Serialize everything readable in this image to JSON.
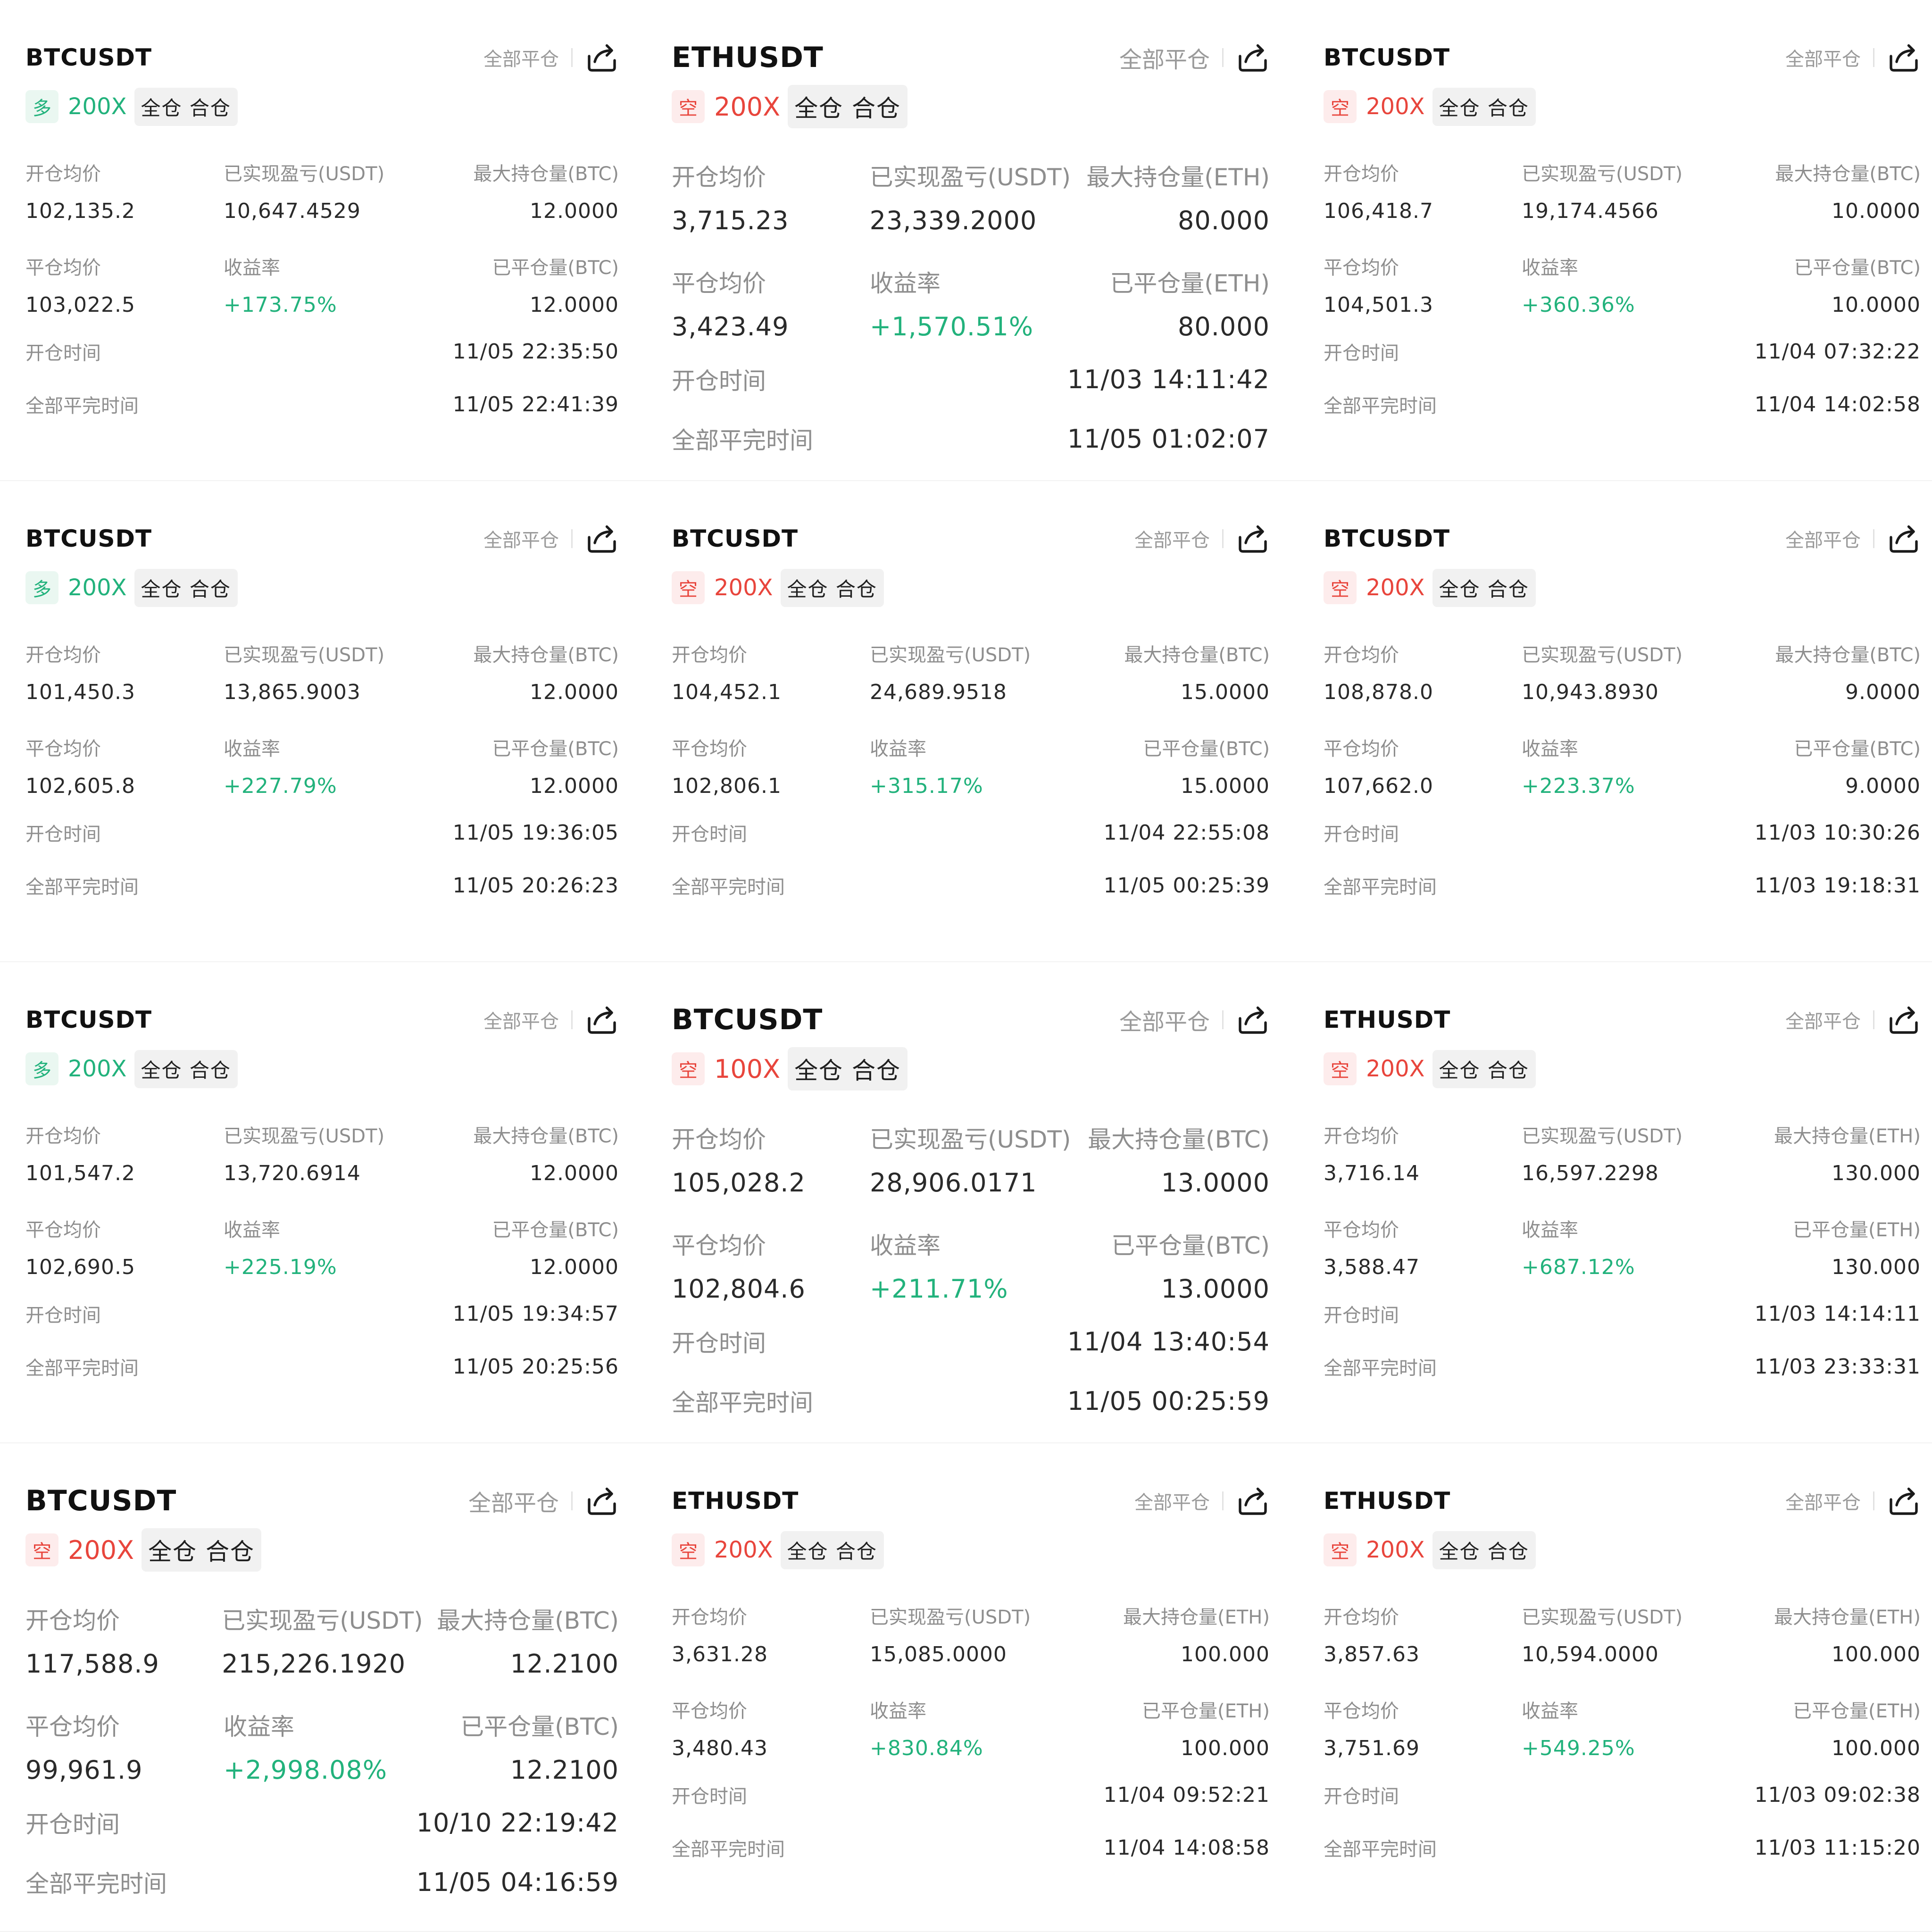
{
  "labels": {
    "close_all": "全部平仓",
    "cross": "全仓 合仓",
    "open_avg": "开仓均价",
    "realized_pnl": "已实现盈亏(USDT)",
    "close_avg": "平仓均价",
    "roi": "收益率",
    "open_time": "开仓时间",
    "close_time": "全部平完时间"
  },
  "colors": {
    "long": "#22b27c",
    "short": "#e8453c",
    "label": "#8e8e8e"
  },
  "cards": [
    {
      "symbol": "BTCUSDT",
      "side": "多",
      "side_type": "long",
      "leverage": "200X",
      "open_avg": "102,135.2",
      "pnl": "10,647.4529",
      "max_label": "最大持仓量(BTC)",
      "max_qty": "12.0000",
      "close_avg": "103,022.5",
      "roi": "+173.75%",
      "closed_label": "已平仓量(BTC)",
      "closed_qty": "12.0000",
      "open_time": "11/05 22:35:50",
      "close_time": "11/05 22:41:39"
    },
    {
      "symbol": "ETHUSDT",
      "side": "空",
      "side_type": "short",
      "leverage": "200X",
      "open_avg": "3,715.23",
      "pnl": "23,339.2000",
      "max_label": "最大持仓量(ETH)",
      "max_qty": "80.000",
      "close_avg": "3,423.49",
      "roi": "+1,570.51%",
      "closed_label": "已平仓量(ETH)",
      "closed_qty": "80.000",
      "open_time": "11/03 14:11:42",
      "close_time": "11/05 01:02:07"
    },
    {
      "symbol": "BTCUSDT",
      "side": "空",
      "side_type": "short",
      "leverage": "200X",
      "open_avg": "106,418.7",
      "pnl": "19,174.4566",
      "max_label": "最大持仓量(BTC)",
      "max_qty": "10.0000",
      "close_avg": "104,501.3",
      "roi": "+360.36%",
      "closed_label": "已平仓量(BTC)",
      "closed_qty": "10.0000",
      "open_time": "11/04 07:32:22",
      "close_time": "11/04 14:02:58"
    },
    {
      "symbol": "BTCUSDT",
      "side": "多",
      "side_type": "long",
      "leverage": "200X",
      "open_avg": "101,450.3",
      "pnl": "13,865.9003",
      "max_label": "最大持仓量(BTC)",
      "max_qty": "12.0000",
      "close_avg": "102,605.8",
      "roi": "+227.79%",
      "closed_label": "已平仓量(BTC)",
      "closed_qty": "12.0000",
      "open_time": "11/05 19:36:05",
      "close_time": "11/05 20:26:23"
    },
    {
      "symbol": "BTCUSDT",
      "side": "空",
      "side_type": "short",
      "leverage": "200X",
      "open_avg": "104,452.1",
      "pnl": "24,689.9518",
      "max_label": "最大持仓量(BTC)",
      "max_qty": "15.0000",
      "close_avg": "102,806.1",
      "roi": "+315.17%",
      "closed_label": "已平仓量(BTC)",
      "closed_qty": "15.0000",
      "open_time": "11/04 22:55:08",
      "close_time": "11/05 00:25:39"
    },
    {
      "symbol": "BTCUSDT",
      "side": "空",
      "side_type": "short",
      "leverage": "200X",
      "open_avg": "108,878.0",
      "pnl": "10,943.8930",
      "max_label": "最大持仓量(BTC)",
      "max_qty": "9.0000",
      "close_avg": "107,662.0",
      "roi": "+223.37%",
      "closed_label": "已平仓量(BTC)",
      "closed_qty": "9.0000",
      "open_time": "11/03 10:30:26",
      "close_time": "11/03 19:18:31"
    },
    {
      "symbol": "BTCUSDT",
      "side": "多",
      "side_type": "long",
      "leverage": "200X",
      "open_avg": "101,547.2",
      "pnl": "13,720.6914",
      "max_label": "最大持仓量(BTC)",
      "max_qty": "12.0000",
      "close_avg": "102,690.5",
      "roi": "+225.19%",
      "closed_label": "已平仓量(BTC)",
      "closed_qty": "12.0000",
      "open_time": "11/05 19:34:57",
      "close_time": "11/05 20:25:56"
    },
    {
      "symbol": "BTCUSDT",
      "side": "空",
      "side_type": "short",
      "leverage": "100X",
      "open_avg": "105,028.2",
      "pnl": "28,906.0171",
      "max_label": "最大持仓量(BTC)",
      "max_qty": "13.0000",
      "close_avg": "102,804.6",
      "roi": "+211.71%",
      "closed_label": "已平仓量(BTC)",
      "closed_qty": "13.0000",
      "open_time": "11/04 13:40:54",
      "close_time": "11/05 00:25:59"
    },
    {
      "symbol": "ETHUSDT",
      "side": "空",
      "side_type": "short",
      "leverage": "200X",
      "open_avg": "3,716.14",
      "pnl": "16,597.2298",
      "max_label": "最大持仓量(ETH)",
      "max_qty": "130.000",
      "close_avg": "3,588.47",
      "roi": "+687.12%",
      "closed_label": "已平仓量(ETH)",
      "closed_qty": "130.000",
      "open_time": "11/03 14:14:11",
      "close_time": "11/03 23:33:31"
    },
    {
      "symbol": "BTCUSDT",
      "side": "空",
      "side_type": "short",
      "leverage": "200X",
      "open_avg": "117,588.9",
      "pnl": "215,226.1920",
      "max_label": "最大持仓量(BTC)",
      "max_qty": "12.2100",
      "close_avg": "99,961.9",
      "roi": "+2,998.08%",
      "closed_label": "已平仓量(BTC)",
      "closed_qty": "12.2100",
      "open_time": "10/10 22:19:42",
      "close_time": "11/05 04:16:59"
    },
    {
      "symbol": "ETHUSDT",
      "side": "空",
      "side_type": "short",
      "leverage": "200X",
      "open_avg": "3,631.28",
      "pnl": "15,085.0000",
      "max_label": "最大持仓量(ETH)",
      "max_qty": "100.000",
      "close_avg": "3,480.43",
      "roi": "+830.84%",
      "closed_label": "已平仓量(ETH)",
      "closed_qty": "100.000",
      "open_time": "11/04 09:52:21",
      "close_time": "11/04 14:08:58"
    },
    {
      "symbol": "ETHUSDT",
      "side": "空",
      "side_type": "short",
      "leverage": "200X",
      "open_avg": "3,857.63",
      "pnl": "10,594.0000",
      "max_label": "最大持仓量(ETH)",
      "max_qty": "100.000",
      "close_avg": "3,751.69",
      "roi": "+549.25%",
      "closed_label": "已平仓量(ETH)",
      "closed_qty": "100.000",
      "open_time": "11/03 09:02:38",
      "close_time": "11/03 11:15:20"
    }
  ]
}
